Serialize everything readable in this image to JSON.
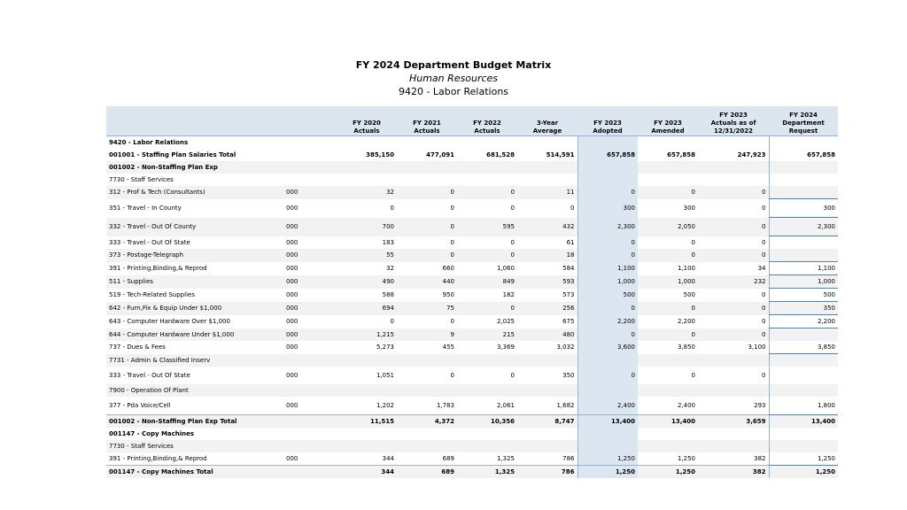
{
  "title": "FY 2024 Department Budget Matrix",
  "subtitle": "Human Resources",
  "unit": "9420 - Labor Relations",
  "headers": [
    "",
    "",
    "FY 2020\nActuals",
    "FY 2021\nActuals",
    "FY 2022\nActuals",
    "3-Year\nAverage",
    "FY 2023\nAdopted",
    "FY 2023\nAmended",
    "FY 2023\nActuals as of\n12/31/2022",
    "FY 2024\nDepartment\nRequest"
  ],
  "rows": [
    {
      "label": "9420 - Labor Relations",
      "code": "",
      "v": [
        "",
        "",
        "",
        "",
        "",
        "",
        "",
        ""
      ],
      "indent": 0,
      "bold": true,
      "h": "small",
      "shade": false,
      "box": false
    },
    {
      "label": "001001 - Staffing Plan Salaries Total",
      "code": "",
      "v": [
        "385,150",
        "477,091",
        "681,528",
        "514,591",
        "657,858",
        "657,858",
        "247,923",
        "657,858"
      ],
      "indent": 1,
      "bold": true,
      "h": "small",
      "shade": false,
      "box": false
    },
    {
      "label": "001002 - Non-Staffing Plan Exp",
      "code": "",
      "v": [
        "",
        "",
        "",
        "",
        "",
        "",
        "",
        ""
      ],
      "indent": 1,
      "bold": true,
      "h": "small",
      "shade": true,
      "box": false
    },
    {
      "label": "7730 - Staff Services",
      "code": "",
      "v": [
        "",
        "",
        "",
        "",
        "",
        "",
        "",
        ""
      ],
      "indent": 2,
      "bold": false,
      "h": "small",
      "shade": false,
      "box": false
    },
    {
      "label": "312 - Prof & Tech (Consultants)",
      "code": "000",
      "v": [
        "32",
        "0",
        "0",
        "11",
        "0",
        "0",
        "0",
        ""
      ],
      "indent": 3,
      "bold": false,
      "h": "small",
      "shade": true,
      "box": true
    },
    {
      "label": "351 - Travel - In County",
      "code": "000",
      "v": [
        "0",
        "0",
        "0",
        "0",
        "300",
        "300",
        "0",
        "300"
      ],
      "indent": 3,
      "bold": false,
      "h": "tall",
      "shade": false,
      "box": true
    },
    {
      "label": "332 - Travel - Out Of County",
      "code": "000",
      "v": [
        "700",
        "0",
        "595",
        "432",
        "2,300",
        "2,050",
        "0",
        "2,300"
      ],
      "indent": 3,
      "bold": false,
      "h": "tall",
      "shade": true,
      "box": true
    },
    {
      "label": "333 - Travel - Out Of State",
      "code": "000",
      "v": [
        "183",
        "0",
        "0",
        "61",
        "0",
        "0",
        "0",
        ""
      ],
      "indent": 3,
      "bold": false,
      "h": "small",
      "shade": false,
      "box": false
    },
    {
      "label": "373 - Postage-Telegraph",
      "code": "000",
      "v": [
        "55",
        "0",
        "0",
        "18",
        "0",
        "0",
        "0",
        ""
      ],
      "indent": 3,
      "bold": false,
      "h": "small",
      "shade": true,
      "box": true
    },
    {
      "label": "391 - Printing,Binding,& Reprod",
      "code": "000",
      "v": [
        "32",
        "660",
        "1,060",
        "584",
        "1,100",
        "1,100",
        "34",
        "1,100"
      ],
      "indent": 3,
      "bold": false,
      "h": "small",
      "shade": false,
      "box": true
    },
    {
      "label": "511 - Supplies",
      "code": "000",
      "v": [
        "490",
        "440",
        "849",
        "593",
        "1,000",
        "1,000",
        "232",
        "1,000"
      ],
      "indent": 3,
      "bold": false,
      "h": "small",
      "shade": true,
      "box": true
    },
    {
      "label": "519 - Tech-Related Supplies",
      "code": "000",
      "v": [
        "588",
        "950",
        "182",
        "573",
        "500",
        "500",
        "0",
        "500"
      ],
      "indent": 3,
      "bold": false,
      "h": "small",
      "shade": false,
      "box": true
    },
    {
      "label": "642 - Furn,Fix & Equip Under $1,000",
      "code": "000",
      "v": [
        "694",
        "75",
        "0",
        "256",
        "0",
        "0",
        "0",
        "350"
      ],
      "indent": 3,
      "bold": false,
      "h": "small",
      "shade": true,
      "box": true
    },
    {
      "label": "643 - Computer Hardware Over $1,000",
      "code": "000",
      "v": [
        "0",
        "0",
        "2,025",
        "675",
        "2,200",
        "2,200",
        "0",
        "2,200"
      ],
      "indent": 3,
      "bold": false,
      "h": "small",
      "shade": false,
      "box": true
    },
    {
      "label": "644 - Computer Hardware Under $1,000",
      "code": "000",
      "v": [
        "1,215",
        "9",
        "215",
        "480",
        "0",
        "0",
        "0",
        ""
      ],
      "indent": 3,
      "bold": false,
      "h": "small",
      "shade": true,
      "box": false
    },
    {
      "label": "737 - Dues & Fees",
      "code": "000",
      "v": [
        "5,273",
        "455",
        "3,369",
        "3,032",
        "3,600",
        "3,850",
        "3,100",
        "3,850"
      ],
      "indent": 3,
      "bold": false,
      "h": "small",
      "shade": false,
      "box": true
    },
    {
      "label": "7731 - Admin & Classified Inserv",
      "code": "",
      "v": [
        "",
        "",
        "",
        "",
        "",
        "",
        "",
        ""
      ],
      "indent": 2,
      "bold": false,
      "h": "small",
      "shade": true,
      "box": false
    },
    {
      "label": "333 - Travel - Out Of State",
      "code": "000",
      "v": [
        "1,051",
        "0",
        "0",
        "350",
        "0",
        "0",
        "0",
        ""
      ],
      "indent": 3,
      "bold": false,
      "h": "tall",
      "shade": false,
      "box": false
    },
    {
      "label": "7900 - Operation Of Plant",
      "code": "",
      "v": [
        "",
        "",
        "",
        "",
        "",
        "",
        "",
        ""
      ],
      "indent": 2,
      "bold": false,
      "h": "small",
      "shade": true,
      "box": false
    },
    {
      "label": "377 - Pda Voice/Cell",
      "code": "000",
      "v": [
        "1,202",
        "1,783",
        "2,061",
        "1,682",
        "2,400",
        "2,400",
        "293",
        "1,800"
      ],
      "indent": 3,
      "bold": false,
      "h": "tall",
      "shade": false,
      "box": true
    },
    {
      "label": "001002 - Non-Staffing Plan Exp Total",
      "code": "",
      "v": [
        "11,515",
        "4,372",
        "10,356",
        "8,747",
        "13,400",
        "13,400",
        "3,659",
        "13,400"
      ],
      "indent": 1,
      "bold": true,
      "h": "small",
      "shade": true,
      "box": false
    },
    {
      "label": "001147 - Copy Machines",
      "code": "",
      "v": [
        "",
        "",
        "",
        "",
        "",
        "",
        "",
        ""
      ],
      "indent": 1,
      "bold": true,
      "h": "small",
      "shade": false,
      "box": false
    },
    {
      "label": "7730 - Staff Services",
      "code": "",
      "v": [
        "",
        "",
        "",
        "",
        "",
        "",
        "",
        ""
      ],
      "indent": 2,
      "bold": false,
      "h": "small",
      "shade": true,
      "box": false
    },
    {
      "label": "391 - Printing,Binding,& Reprod",
      "code": "000",
      "v": [
        "344",
        "689",
        "1,325",
        "786",
        "1,250",
        "1,250",
        "382",
        "1,250"
      ],
      "indent": 3,
      "bold": false,
      "h": "small",
      "shade": false,
      "box": true
    },
    {
      "label": "001147 - Copy Machines Total",
      "code": "",
      "v": [
        "344",
        "689",
        "1,325",
        "786",
        "1,250",
        "1,250",
        "382",
        "1,250"
      ],
      "indent": 1,
      "bold": true,
      "h": "small",
      "shade": true,
      "box": false
    }
  ]
}
